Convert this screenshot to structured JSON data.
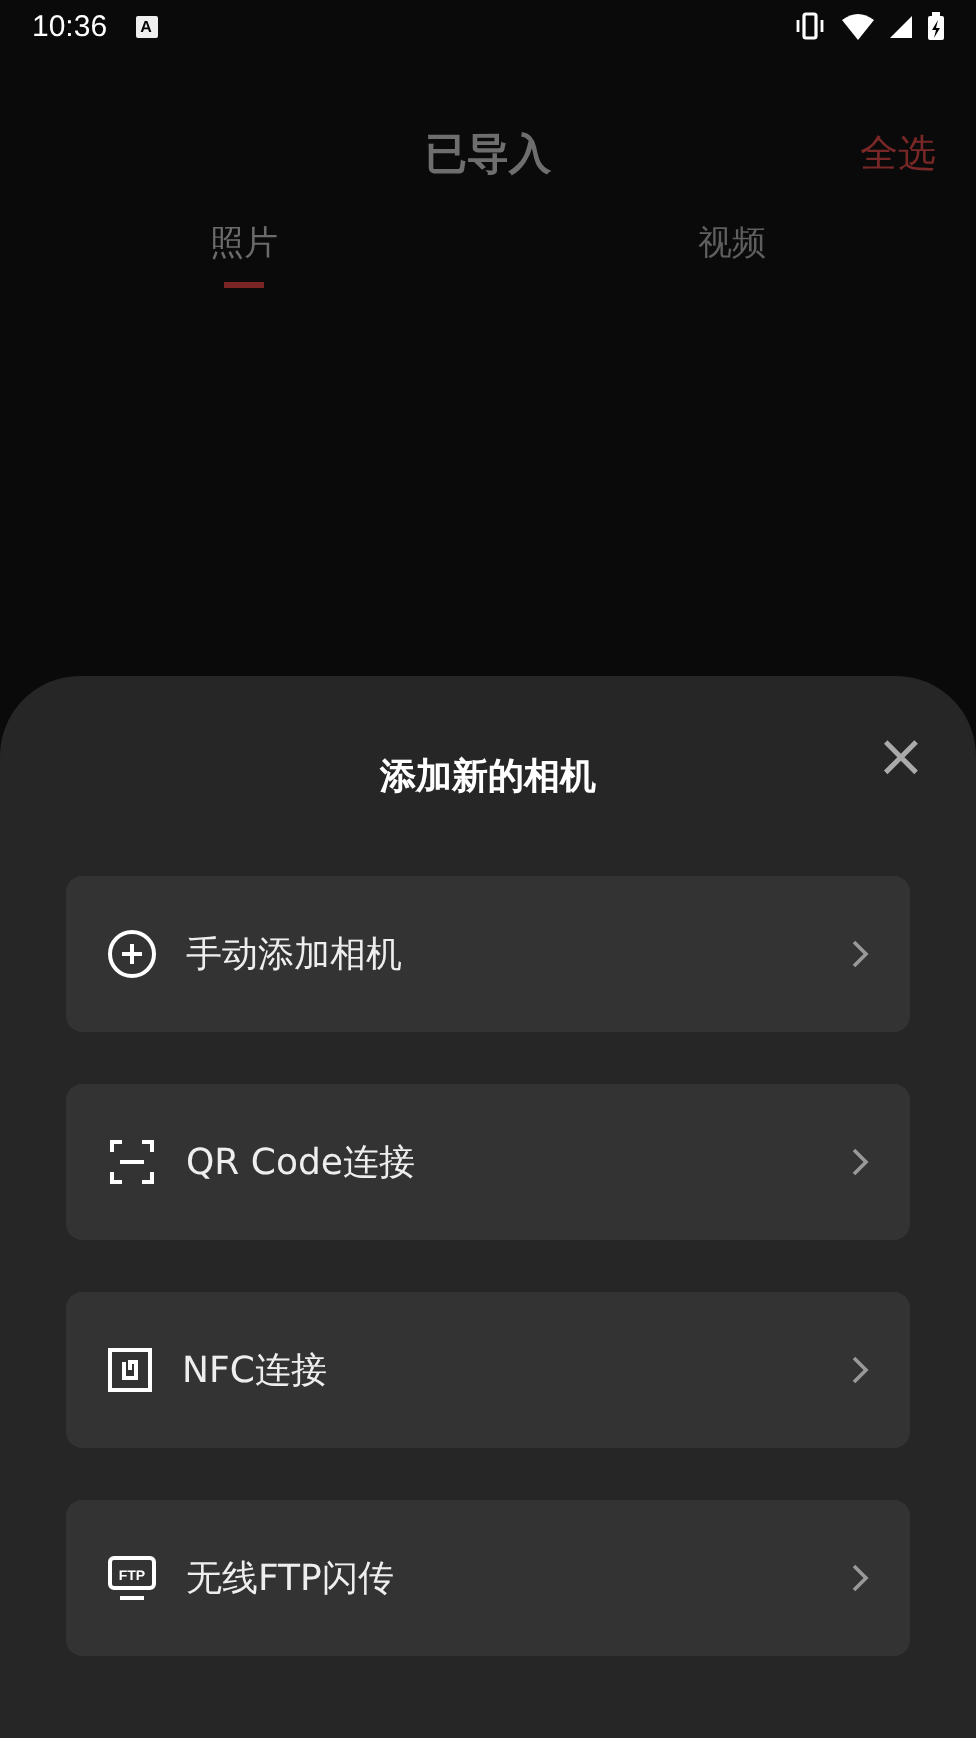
{
  "status_bar": {
    "time": "10:36",
    "notification_icon": "A"
  },
  "header": {
    "title": "已导入",
    "action": "全选"
  },
  "tabs": [
    {
      "label": "照片",
      "selected": true
    },
    {
      "label": "视频",
      "selected": false
    }
  ],
  "sheet": {
    "title": "添加新的相机",
    "close": "×",
    "options": [
      {
        "kind": "plus",
        "label": "手动添加相机"
      },
      {
        "kind": "scan",
        "label": "QR Code连接"
      },
      {
        "kind": "nfc",
        "label": "NFC连接"
      },
      {
        "kind": "ftp",
        "label": "无线FTP闪传",
        "icon_text": "FTP"
      }
    ]
  }
}
